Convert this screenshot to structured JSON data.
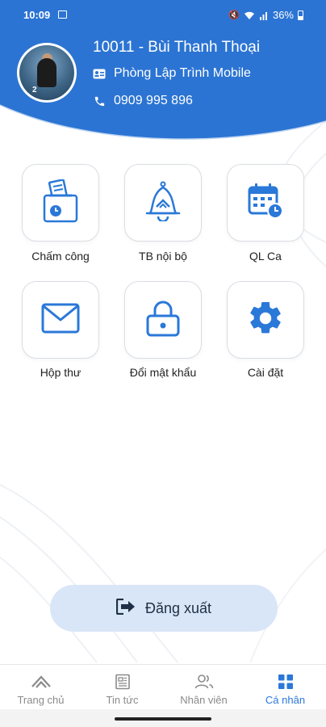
{
  "status_bar": {
    "time": "10:09",
    "battery": "36%"
  },
  "profile": {
    "code_name": "10011 - Bùi Thanh Thoại",
    "department": "Phòng Lập Trình Mobile",
    "phone": "0909 995 896"
  },
  "menu": {
    "items": [
      {
        "label": "Chấm công",
        "icon": "timesheet-icon"
      },
      {
        "label": "TB nội bộ",
        "icon": "bell-icon"
      },
      {
        "label": "QL Ca",
        "icon": "calendar-icon"
      },
      {
        "label": "Hộp thư",
        "icon": "mail-icon"
      },
      {
        "label": "Đổi mật khẩu",
        "icon": "lock-icon"
      },
      {
        "label": "Cài đặt",
        "icon": "gear-icon"
      }
    ]
  },
  "logout": {
    "label": "Đăng xuất"
  },
  "bottom_nav": {
    "items": [
      {
        "label": "Trang chủ"
      },
      {
        "label": "Tin tức"
      },
      {
        "label": "Nhân viên"
      },
      {
        "label": "Cá nhân"
      }
    ],
    "active_index": 3
  },
  "colors": {
    "primary": "#2a78d8",
    "header": "#2b74d3",
    "tile_border": "#d9dde3",
    "logout_bg": "#d9e6f7"
  }
}
